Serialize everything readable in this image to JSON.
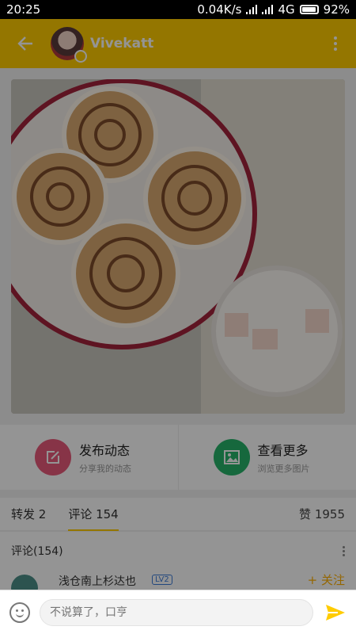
{
  "status_bar": {
    "time": "20:25",
    "speed": "0.04K/s",
    "network": "4G",
    "battery": "92%"
  },
  "header": {
    "username": "Vivekatt",
    "accent": "#ffcc00"
  },
  "actions": [
    {
      "title": "发布动态",
      "subtitle": "分享我的动态",
      "icon": "edit-icon",
      "color": "#e85b7a"
    },
    {
      "title": "查看更多",
      "subtitle": "浏览更多图片",
      "icon": "image-icon",
      "color": "#27b36a"
    }
  ],
  "tabs": [
    {
      "label": "转发 2"
    },
    {
      "label": "评论 154"
    }
  ],
  "likes": "赞 1955",
  "comments": {
    "header": "评论(154)",
    "first": {
      "name": "浅仓南上杉达也",
      "level": "LV2",
      "follow": "+ 关注"
    }
  },
  "input": {
    "placeholder": "不说算了，口亨"
  }
}
